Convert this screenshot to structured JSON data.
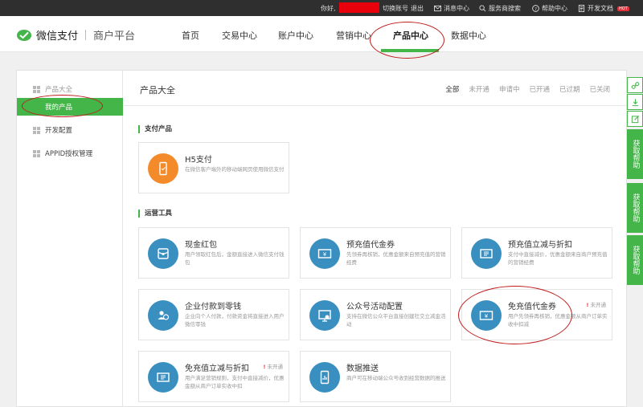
{
  "topbar": {
    "greeting": "你好,",
    "switch_account": "切换账号",
    "logout": "退出",
    "messages": "消息中心",
    "search_provider": "服务商搜索",
    "help": "帮助中心",
    "dev_docs": "开发文档",
    "hot_badge": "HOT"
  },
  "header": {
    "brand": "微信支付",
    "platform": "商户平台",
    "nav": [
      "首页",
      "交易中心",
      "账户中心",
      "营销中心",
      "产品中心",
      "数据中心"
    ],
    "active_nav": "产品中心"
  },
  "sidebar": {
    "items": [
      {
        "label": "产品大全"
      },
      {
        "label": "我的产品"
      },
      {
        "label": "开发配置"
      },
      {
        "label": "APPID授权管理"
      }
    ]
  },
  "content": {
    "title": "产品大全",
    "filters": [
      "全部",
      "未开通",
      "申请中",
      "已开通",
      "已过期",
      "已关闭"
    ],
    "sections": [
      {
        "title": "支付产品",
        "cards": [
          {
            "name": "H5支付",
            "desc": "在微信客户端外的移动端网页使用微信支付",
            "status": "",
            "icon": "phone-icon"
          }
        ]
      },
      {
        "title": "运营工具",
        "cards": [
          {
            "name": "现金红包",
            "desc": "用户领取红包后，金额直接进入微信支付钱包",
            "status": "",
            "icon": "red-packet-icon"
          },
          {
            "name": "预充值代金券",
            "desc": "先领券再核销，优惠金额来自预充值的营销经费",
            "status": "",
            "icon": "voucher-icon"
          },
          {
            "name": "预充值立减与折扣",
            "desc": "支付中直接减价，优惠金额来自商户预充值的营销经费",
            "status": "",
            "icon": "discount-icon"
          },
          {
            "name": "企业付款到零钱",
            "desc": "企业向个人付款，付款资金将直接进入用户微信零钱",
            "status": "",
            "icon": "transfer-icon"
          },
          {
            "name": "公众号活动配置",
            "desc": "支持在微信公众平台直接创建社交立减金活动",
            "status": "",
            "icon": "campaign-icon"
          },
          {
            "name": "免充值代金券",
            "desc": "用户先领券再核销，优惠金额从商户订单实收中扣减",
            "status": "未开通",
            "icon": "voucher-icon"
          },
          {
            "name": "免充值立减与折扣",
            "desc": "用户满足营销规则，支付中直接减价，优惠金额从商户订单实收中扣",
            "status": "未开通",
            "icon": "discount-icon"
          },
          {
            "name": "数据推送",
            "desc": "商户可在移动端公众号收到经营数据的推送",
            "status": "",
            "icon": "data-push-icon"
          }
        ]
      }
    ]
  },
  "float_bar": {
    "help_label": "获取帮助"
  },
  "colors": {
    "accent_green": "#44b549",
    "icon_blue": "#3a8fc1",
    "icon_orange": "#f38b2b",
    "status_red": "#e0303a",
    "annotation_red": "#c01c1c",
    "topbar_bg": "#2f2f2f"
  }
}
